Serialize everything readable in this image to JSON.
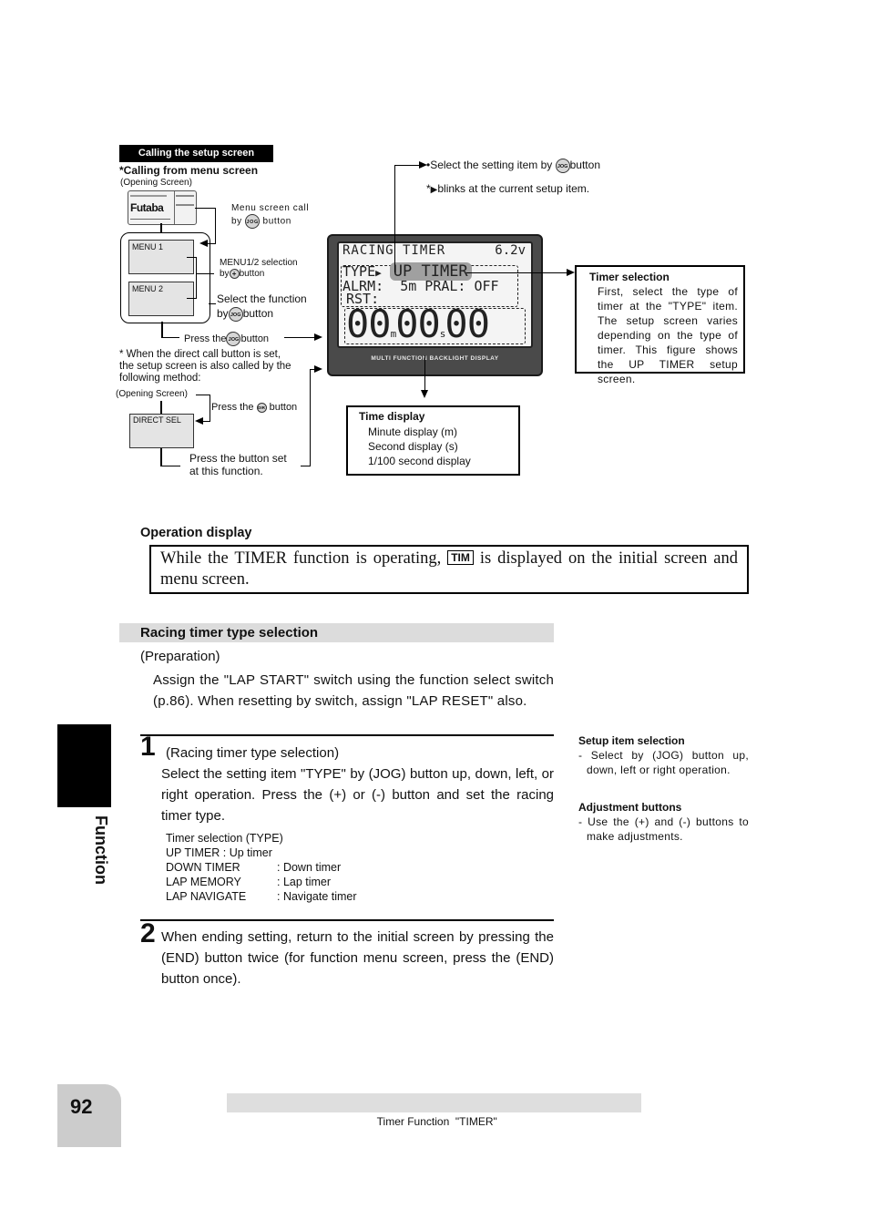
{
  "diagram": {
    "header_label": "Calling the setup screen",
    "from_menu_title": "*Calling from menu screen",
    "opening_screen_label": "(Opening Screen)",
    "opening_logo": "Futaba",
    "menu_call_line1": "Menu screen call",
    "menu_call_by": "by",
    "menu_call_button": "button",
    "menu1_label": "MENU 1",
    "menu2_label": "MENU 2",
    "menu_sel_line1": "MENU1/2 selection",
    "menu_sel_by": "by",
    "menu_sel_button": "button",
    "select_func_line1": "Select the function",
    "select_func_by": "by",
    "select_func_button": "button",
    "press_jog_pre": "Press the",
    "press_jog_post": "button",
    "direct_note": "* When the direct call button is set, the setup screen is also called by the following method:",
    "opening_screen_label_2": "(Opening Screen)",
    "press_dir_pre": "Press the",
    "press_dir_post": "button",
    "direct_sel_label": "DIRECT SEL",
    "press_button_set_line1": "Press the button set",
    "press_button_set_line2": "at this function.",
    "jog_icon_label": "JOG",
    "plus_icon_label": "+",
    "dir_icon_label": "DIR",
    "select_item_note": "•Select the setting item by",
    "select_item_button": "button",
    "blinks_note_pre": "*",
    "blinks_note": "blinks at the current setup item.",
    "lcd": {
      "title": "RACING TIMER",
      "voltage": "6.2v",
      "row1_label": "TYPE",
      "row1_value": "UP TIMER",
      "row2_label": "ALRM:",
      "row2_value": "5m PRAL: OFF",
      "row3_label": "RST:",
      "time_min": "00",
      "time_sec": "00",
      "time_hund": "00",
      "unit_min": "m",
      "unit_sec": "s",
      "footer": "MULTI FUNCTION BACKLIGHT DISPLAY"
    },
    "timer_selection_box": {
      "title": "Timer selection",
      "text": "First, select the type of timer at the \"TYPE\" item. The setup screen varies depending on the type of timer. This figure shows the UP TIMER setup screen."
    },
    "time_display_box": {
      "title": "Time display",
      "lines": [
        "Minute display (m)",
        "Second display (s)",
        "1/100 second display"
      ]
    }
  },
  "operation_display": {
    "heading": "Operation display",
    "text_pre": "While the TIMER function is operating,",
    "badge": "TIM",
    "text_post": "is displayed on the initial screen and menu screen."
  },
  "section": {
    "title": "Racing timer type selection",
    "preparation_label": "(Preparation)",
    "preparation_text": "Assign the \"LAP START\" switch using the function select switch (p.86). When resetting by switch, assign \"LAP RESET\" also.",
    "step1": {
      "number": "1",
      "subtitle": "(Racing timer type selection)",
      "text": "Select the setting item \"TYPE\" by (JOG) button up, down, left, or right operation. Press the (+) or (-) button and set the racing timer type.",
      "list_title": "Timer selection (TYPE)",
      "list_first": "UP TIMER : Up timer",
      "list": [
        {
          "name": "DOWN TIMER",
          "desc": ": Down timer"
        },
        {
          "name": "LAP MEMORY",
          "desc": ": Lap timer"
        },
        {
          "name": "LAP NAVIGATE",
          "desc": ": Navigate timer"
        }
      ]
    },
    "step2": {
      "number": "2",
      "text": "When ending setting, return to the initial screen by pressing the (END) button twice (for function menu screen, press the (END) button once)."
    }
  },
  "side_notes": {
    "setup_title": "Setup item selection",
    "setup_text": "- Select by (JOG) button up, down, left or right operation.",
    "adjust_title": "Adjustment buttons",
    "adjust_text": "- Use the (+) and (-) buttons to make adjustments."
  },
  "side_tab": {
    "label": "Function"
  },
  "footer": {
    "page_number": "92",
    "title": "Timer Function  \"TIMER\""
  }
}
